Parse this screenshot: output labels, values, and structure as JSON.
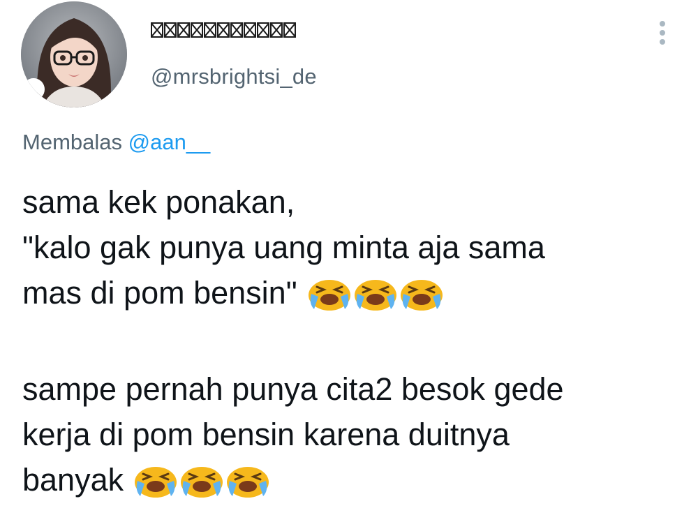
{
  "author": {
    "display_name": "▯▯▯▯▯▯▯▯▯▯▯",
    "display_name_glyph_count": 11,
    "handle": "@mrsbrightsi_de",
    "avatar": "avatar-icon"
  },
  "more_menu": {
    "icon": "more-vertical-icon"
  },
  "reply": {
    "prefix": "Membalas",
    "mention": "@aan__"
  },
  "tweet": {
    "paragraph_1_line_1": "sama kek ponakan,",
    "paragraph_1_line_2": "\"kalo gak punya uang minta aja sama",
    "paragraph_1_line_3": "mas di pom bensin\"",
    "paragraph_2_line_1": "sampe pernah punya cita2 besok gede",
    "paragraph_2_line_2": "kerja di pom bensin karena duitnya",
    "paragraph_2_line_3": "banyak",
    "emoji": "loudly-crying-face-icon",
    "emoji_count_per_group": 3
  },
  "colors": {
    "text": "#0f1419",
    "secondary": "#536471",
    "link": "#1d9bf0",
    "dots": "#aab8c2",
    "emoji_face": "#f6b81c"
  }
}
